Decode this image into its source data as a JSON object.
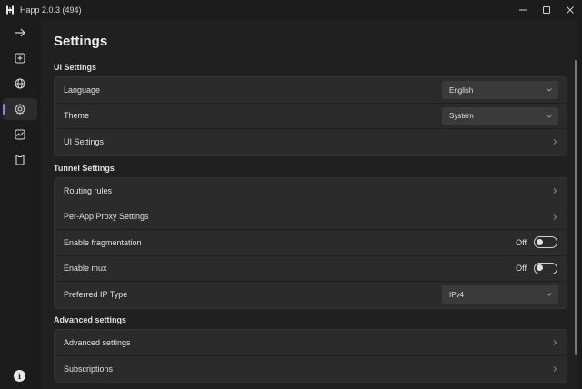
{
  "window": {
    "title": "Happ 2.0.3 (494)",
    "controls": {
      "minimize_icon": "minimize-icon",
      "maximize_icon": "maximize-icon",
      "close_icon": "close-icon"
    }
  },
  "sidebar": {
    "items": [
      {
        "name": "forward",
        "icon": "arrow-right-icon"
      },
      {
        "name": "add",
        "icon": "plus-square-icon"
      },
      {
        "name": "servers",
        "icon": "globe-icon"
      },
      {
        "name": "settings",
        "icon": "gear-icon",
        "active": true
      },
      {
        "name": "stats",
        "icon": "activity-chart-icon"
      },
      {
        "name": "clipboard",
        "icon": "clipboard-icon"
      }
    ],
    "info_label": "i"
  },
  "main": {
    "title": "Settings",
    "ui_settings": {
      "header": "UI Settings",
      "language": {
        "label": "Language",
        "value": "English"
      },
      "theme": {
        "label": "Theme",
        "value": "System"
      },
      "ui_settings_link": "UI Settings"
    },
    "tunnel_settings": {
      "header": "Tunnel Settings",
      "routing_rules": "Routing rules",
      "per_app_proxy": "Per-App Proxy Settings",
      "fragmentation": {
        "label": "Enable fragmentation",
        "state": "Off"
      },
      "mux": {
        "label": "Enable mux",
        "state": "Off"
      },
      "preferred_ip": {
        "label": "Preferred IP Type",
        "value": "IPv4"
      }
    },
    "advanced_settings": {
      "header": "Advanced settings",
      "advanced_link": "Advanced settings",
      "subscriptions_link": "Subscriptions"
    }
  },
  "colors": {
    "background": "#1c1c1c",
    "card": "#2b2b2b",
    "accent": "#8a7fff",
    "text": "#e6e6e6"
  }
}
